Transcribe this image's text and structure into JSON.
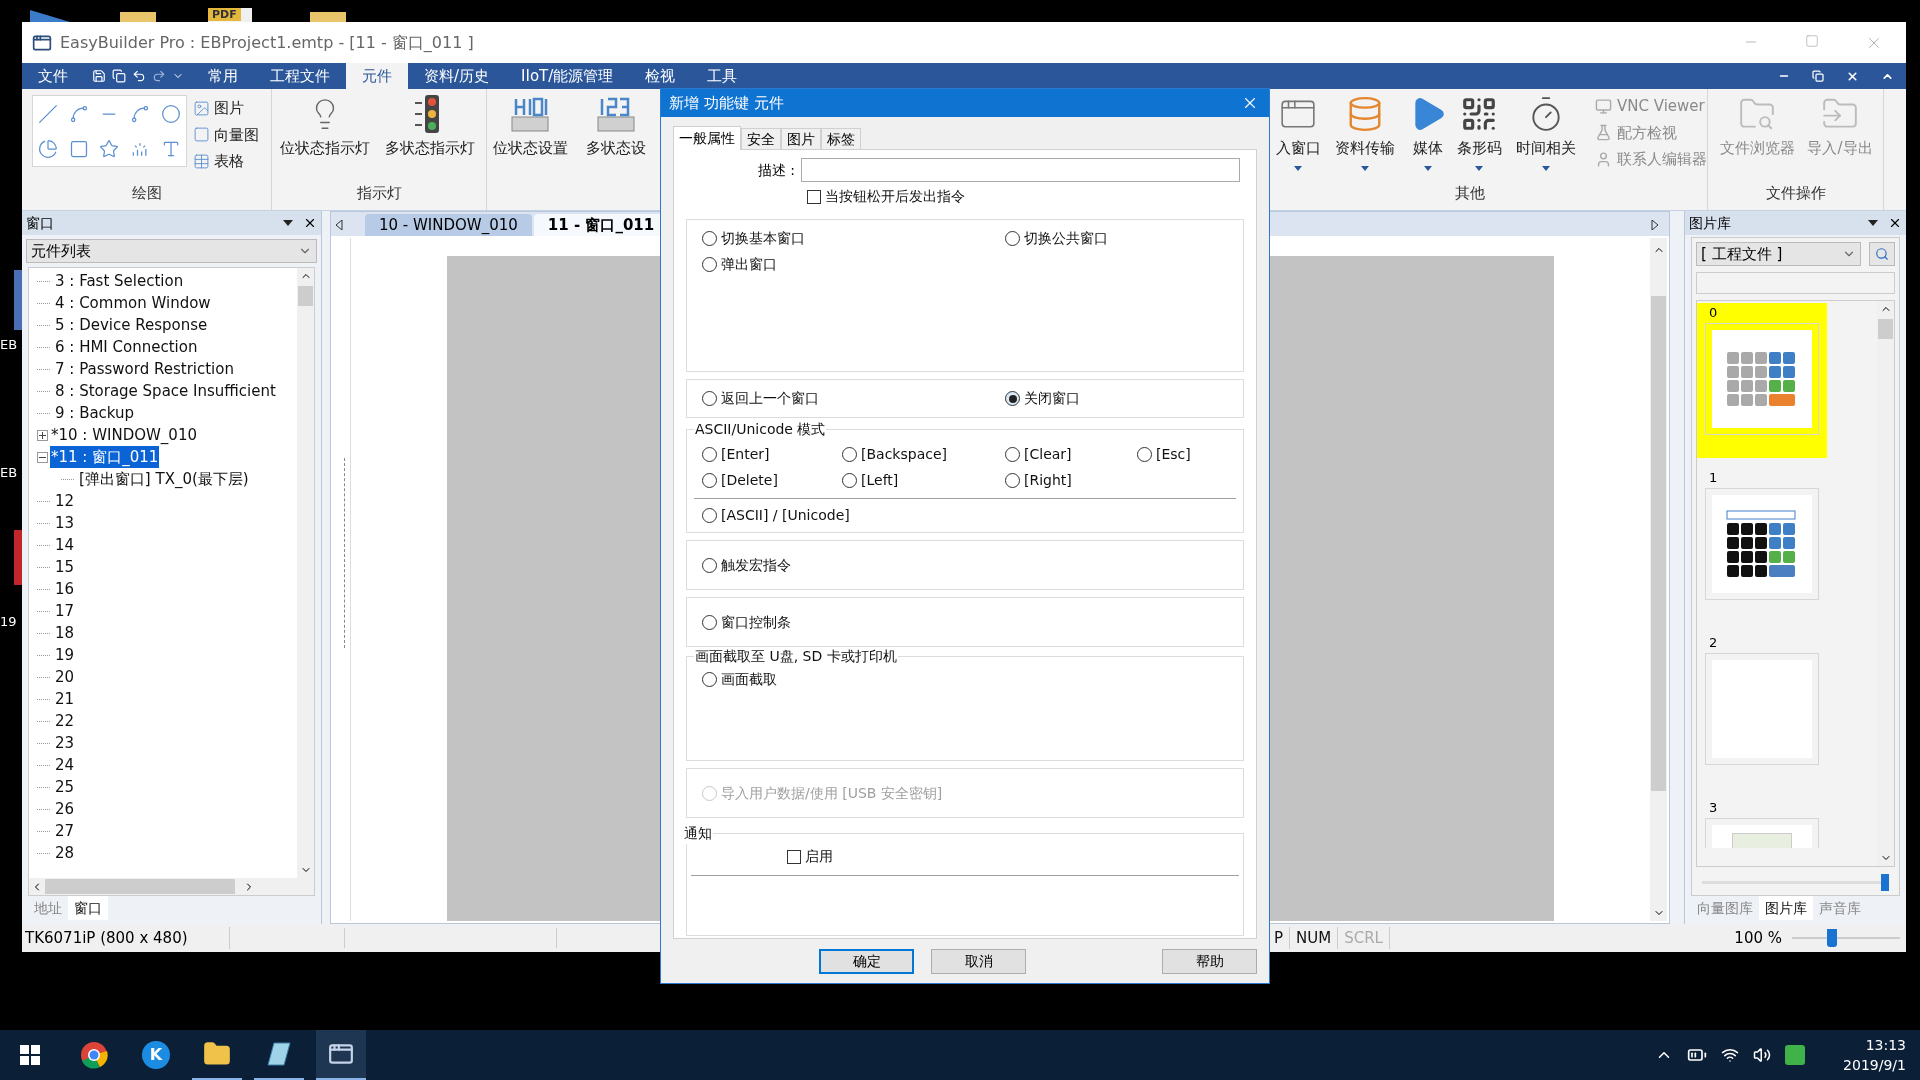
{
  "desktop": {
    "badge": "PDF",
    "labels": [
      "EB",
      "EB",
      "19"
    ]
  },
  "window": {
    "title": "EasyBuilder Pro : EBProject1.emtp - [11 - 窗口_011 ]"
  },
  "menu": [
    {
      "label": "文件",
      "selected": false
    },
    {
      "label": "常用",
      "selected": false
    },
    {
      "label": "工程文件",
      "selected": false
    },
    {
      "label": "元件",
      "selected": true
    },
    {
      "label": "资料/历史",
      "selected": false
    },
    {
      "label": "IIoT/能源管理",
      "selected": false
    },
    {
      "label": "检视",
      "selected": false
    },
    {
      "label": "工具",
      "selected": false
    }
  ],
  "ribbon": {
    "drawing_group": {
      "label": "绘图",
      "items": [
        "图片",
        "向量图",
        "表格"
      ]
    },
    "indicator_group": {
      "label": "指示灯",
      "buttons": [
        "位状态指示灯",
        "多状态指示灯"
      ]
    },
    "setting_buttons": [
      "位状态设置",
      "多状态设"
    ],
    "other_group": {
      "label": "其他",
      "buttons": [
        "入窗口",
        "资料传输",
        "媒体",
        "条形码",
        "时间相关"
      ],
      "links": [
        "VNC Viewer",
        "配方检视",
        "联系人编辑器"
      ]
    },
    "file_group": {
      "label": "文件操作",
      "buttons": [
        "文件浏览器",
        "导入/导出"
      ]
    }
  },
  "left_panel": {
    "title": "窗口",
    "dropdown": "元件列表",
    "tree": [
      {
        "label": "3 : Fast Selection",
        "selected": false
      },
      {
        "label": "4 : Common Window",
        "selected": false
      },
      {
        "label": "5 : Device Response",
        "selected": false
      },
      {
        "label": "6 : HMI Connection",
        "selected": false
      },
      {
        "label": "7 : Password Restriction",
        "selected": false
      },
      {
        "label": "8 : Storage Space Insufficient",
        "selected": false
      },
      {
        "label": "9 : Backup",
        "selected": false
      },
      {
        "label": "*10 : WINDOW_010",
        "selected": false,
        "expanded": false
      },
      {
        "label": "*11 : 窗口_011",
        "selected": true,
        "expanded": true,
        "children": [
          {
            "label": "[弹出窗口] TX_0(最下层)",
            "selected": false
          }
        ]
      },
      {
        "label": "12",
        "selected": false
      },
      {
        "label": "13",
        "selected": false
      },
      {
        "label": "14",
        "selected": false
      },
      {
        "label": "15",
        "selected": false
      },
      {
        "label": "16",
        "selected": false
      },
      {
        "label": "17",
        "selected": false
      },
      {
        "label": "18",
        "selected": false
      },
      {
        "label": "19",
        "selected": false
      },
      {
        "label": "20",
        "selected": false
      },
      {
        "label": "21",
        "selected": false
      },
      {
        "label": "22",
        "selected": false
      },
      {
        "label": "23",
        "selected": false
      },
      {
        "label": "24",
        "selected": false
      },
      {
        "label": "25",
        "selected": false
      },
      {
        "label": "26",
        "selected": false
      },
      {
        "label": "27",
        "selected": false
      },
      {
        "label": "28",
        "selected": false
      }
    ],
    "tabs": [
      {
        "label": "地址",
        "selected": false
      },
      {
        "label": "窗口",
        "selected": true
      }
    ]
  },
  "editor": {
    "tabs": [
      {
        "label": "10 - WINDOW_010",
        "selected": false
      },
      {
        "label": "11 - 窗口_011",
        "selected": true
      }
    ]
  },
  "right_panel": {
    "title": "图片库",
    "dropdown": "[ 工程文件 ]",
    "items": [
      {
        "label": "0",
        "selected": true
      },
      {
        "label": "1",
        "selected": false
      },
      {
        "label": "2",
        "selected": false
      },
      {
        "label": "3",
        "selected": false
      }
    ],
    "size_slider": {
      "level": 1
    },
    "tabs": [
      {
        "label": "向量图库",
        "selected": false
      },
      {
        "label": "图片库",
        "selected": true
      },
      {
        "label": "声音库",
        "selected": false
      }
    ]
  },
  "status_bar": {
    "device": "TK6071iP (800 x 480)",
    "indicators": [
      {
        "label": "P",
        "disabled": false
      },
      {
        "label": "NUM",
        "disabled": false
      },
      {
        "label": "SCRL",
        "disabled": true
      }
    ],
    "zoom": {
      "reading": "100 %",
      "level": 0.37
    }
  },
  "dialog": {
    "title": "新增 功能键 元件",
    "tabs": [
      {
        "label": "一般属性",
        "selected": true
      },
      {
        "label": "安全",
        "selected": false
      },
      {
        "label": "图片",
        "selected": false
      },
      {
        "label": "标签",
        "selected": false
      }
    ],
    "description": {
      "label": "描述 :"
    },
    "release_checkbox": {
      "label": "当按钮松开后发出指令",
      "checked": false
    },
    "sections": [
      {
        "kind": "wide",
        "options": [
          {
            "label": "切换基本窗口",
            "selected": false,
            "disabled": false
          },
          {
            "label": "切换公共窗口",
            "selected": false,
            "disabled": false
          },
          {
            "label": "弹出窗口",
            "selected": false,
            "disabled": false
          }
        ]
      },
      {
        "kind": "pair",
        "options": [
          {
            "label": "返回上一个窗口",
            "selected": false,
            "disabled": false
          },
          {
            "label": "关闭窗口",
            "selected": true,
            "disabled": false
          }
        ]
      },
      {
        "kind": "keys",
        "legend": "ASCII/Unicode 模式",
        "options": [
          {
            "label": "[Enter]",
            "selected": false,
            "disabled": false
          },
          {
            "label": "[Backspace]",
            "selected": false,
            "disabled": false
          },
          {
            "label": "[Clear]",
            "selected": false,
            "disabled": false
          },
          {
            "label": "[Esc]",
            "selected": false,
            "disabled": false
          },
          {
            "label": "[Delete]",
            "selected": false,
            "disabled": false
          },
          {
            "label": "[Left]",
            "selected": false,
            "disabled": false
          },
          {
            "label": "[Right]",
            "selected": false,
            "disabled": false
          }
        ],
        "extra_options": [
          {
            "label": "[ASCII] / [Unicode]",
            "selected": false,
            "disabled": false
          }
        ]
      },
      {
        "kind": "single",
        "options": [
          {
            "label": "触发宏指令",
            "selected": false,
            "disabled": false
          }
        ]
      },
      {
        "kind": "single",
        "options": [
          {
            "label": "窗口控制条",
            "selected": false,
            "disabled": false
          }
        ]
      },
      {
        "kind": "capture",
        "legend": "画面截取至 U盘, SD 卡或打印机",
        "options": [
          {
            "label": "画面截取",
            "selected": false,
            "disabled": false
          }
        ]
      },
      {
        "kind": "single",
        "options": [
          {
            "label": "导入用户数据/使用 [USB 安全密钥]",
            "selected": false,
            "disabled": true
          }
        ]
      },
      {
        "kind": "notice",
        "legend": "通知",
        "checkbox": {
          "label": "启用",
          "checked": false
        }
      }
    ],
    "buttons": [
      {
        "label": "确定",
        "default": true
      },
      {
        "label": "取消",
        "default": false
      },
      {
        "label": "帮助",
        "default": false
      }
    ]
  },
  "taskbar": {
    "app_letter": "K",
    "time": "13:13",
    "date": "2019/9/1"
  }
}
